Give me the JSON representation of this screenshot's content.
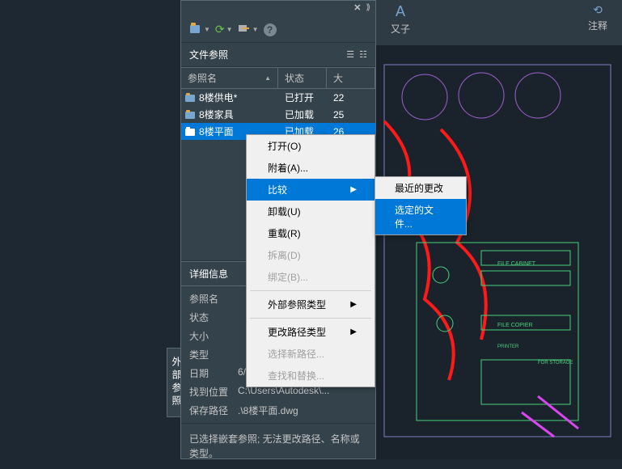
{
  "ribbon": {
    "group1": {
      "label": "又子",
      "dropdown": "▾"
    },
    "group2": {
      "label": "注释"
    }
  },
  "panel": {
    "title": "文件参照",
    "columns": {
      "name": "参照名",
      "status": "状态",
      "size": "大"
    },
    "rows": [
      {
        "name": "8楼供电*",
        "status": "已打开",
        "size": "22",
        "selected": false,
        "iconColor": "#d9a94a"
      },
      {
        "name": "8楼家具",
        "status": "已加载",
        "size": "25",
        "selected": false,
        "iconColor": "#d9a94a"
      },
      {
        "name": "8楼平面",
        "status": "已加载",
        "size": "26",
        "selected": true,
        "iconColor": "#ffffff"
      }
    ],
    "details_title": "详细信息",
    "details": [
      {
        "label": "参照名",
        "value": ""
      },
      {
        "label": "状态",
        "value": ""
      },
      {
        "label": "大小",
        "value": ""
      },
      {
        "label": "类型",
        "value": ""
      },
      {
        "label": "日期",
        "value": "6/10/2019 2:43:12 PM"
      },
      {
        "label": "找到位置",
        "value": "C:\\Users\\Autodesk\\..."
      },
      {
        "label": "保存路径",
        "value": ".\\8楼平面.dwg"
      }
    ],
    "footer": "已选择嵌套参照; 无法更改路径、名称或类型。",
    "vertical_tab": "外部参照"
  },
  "context_menu": {
    "items": [
      {
        "label": "打开(O)",
        "enabled": true
      },
      {
        "label": "附着(A)...",
        "enabled": true
      },
      {
        "label": "比较",
        "enabled": true,
        "submenu": true,
        "highlighted": true
      },
      {
        "label": "卸载(U)",
        "enabled": true
      },
      {
        "label": "重载(R)",
        "enabled": true
      },
      {
        "label": "拆离(D)",
        "enabled": false
      },
      {
        "label": "绑定(B)...",
        "enabled": false
      },
      {
        "label": "外部参照类型",
        "enabled": true,
        "submenu": true,
        "sep_before": true
      },
      {
        "label": "更改路径类型",
        "enabled": true,
        "submenu": true,
        "sep_before": true
      },
      {
        "label": "选择新路径...",
        "enabled": false
      },
      {
        "label": "查找和替换...",
        "enabled": false
      }
    ]
  },
  "submenu": {
    "items": [
      {
        "label": "最近的更改",
        "highlighted": false
      },
      {
        "label": "选定的文件...",
        "highlighted": true
      }
    ]
  }
}
